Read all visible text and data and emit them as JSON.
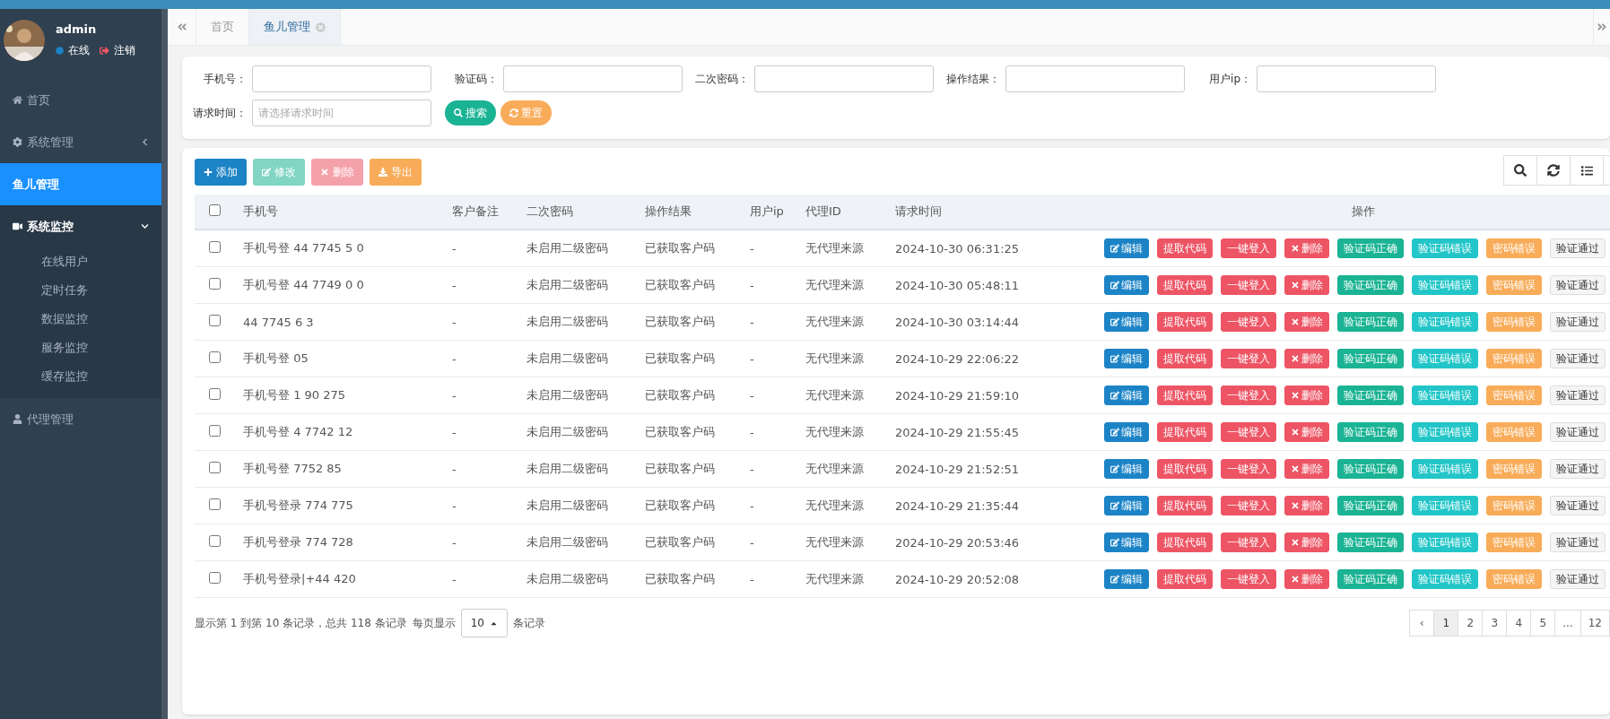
{
  "user": {
    "name": "admin",
    "status": "在线",
    "logout": "注销"
  },
  "sidebar": {
    "items": [
      {
        "label": "首页",
        "selected": false
      },
      {
        "label": "系统管理",
        "selected": false,
        "expanded": false
      },
      {
        "label": "鱼儿管理",
        "selected": true
      },
      {
        "label": "系统监控",
        "selected": false,
        "expanded": true,
        "children": [
          {
            "label": "在线用户",
            "selected": false
          },
          {
            "label": "定时任务",
            "selected": false
          },
          {
            "label": "数据监控",
            "selected": false
          },
          {
            "label": "服务监控",
            "selected": false
          },
          {
            "label": "缓存监控",
            "selected": false
          }
        ]
      },
      {
        "label": "代理管理",
        "selected": false
      }
    ]
  },
  "tabs": [
    {
      "label": "首页",
      "selected": false
    },
    {
      "label": "鱼儿管理",
      "selected": true
    }
  ],
  "filters": {
    "fields": [
      {
        "label": "手机号："
      },
      {
        "label": "验证码："
      },
      {
        "label": "二次密码："
      },
      {
        "label": "操作结果："
      },
      {
        "label": "用户ip："
      },
      {
        "label": "请求时间：",
        "placeholder": "请选择请求时间"
      }
    ],
    "buttons": [
      "搜索",
      "重置"
    ]
  },
  "toolbar": [
    {
      "label": "添加",
      "disabled": false
    },
    {
      "label": "修改",
      "disabled": true
    },
    {
      "label": "删除",
      "disabled": true
    },
    {
      "label": "导出",
      "disabled": false
    }
  ],
  "table": {
    "select_all": {
      "checked": false
    },
    "columns": [
      "手机号",
      "客户备注",
      "二次密码",
      "操作结果",
      "用户ip",
      "代理ID",
      "请求时间",
      "操作"
    ],
    "rows": [
      {
        "checked": false,
        "cells": [
          "手机号登 44 7745 5 0",
          "-",
          "未启用二级密码",
          "已获取客户码",
          "-",
          "无代理来源",
          "2024-10-30 06:31:25"
        ],
        "actions": [
          "编辑",
          "提取代码",
          "一键登入",
          "删除",
          "验证码正确",
          "验证码错误",
          "密码错误",
          "验证通过"
        ]
      },
      {
        "checked": false,
        "cells": [
          "手机号登 44 7749 0 0",
          "-",
          "未启用二级密码",
          "已获取客户码",
          "-",
          "无代理来源",
          "2024-10-30 05:48:11"
        ],
        "actions": [
          "编辑",
          "提取代码",
          "一键登入",
          "删除",
          "验证码正确",
          "验证码错误",
          "密码错误",
          "验证通过"
        ]
      },
      {
        "checked": false,
        "cells": [
          "44 7745 6 3",
          "-",
          "未启用二级密码",
          "已获取客户码",
          "-",
          "无代理来源",
          "2024-10-30 03:14:44"
        ],
        "actions": [
          "编辑",
          "提取代码",
          "一键登入",
          "删除",
          "验证码正确",
          "验证码错误",
          "密码错误",
          "验证通过"
        ]
      },
      {
        "checked": false,
        "cells": [
          "手机号登 05",
          "-",
          "未启用二级密码",
          "已获取客户码",
          "-",
          "无代理来源",
          "2024-10-29 22:06:22"
        ],
        "actions": [
          "编辑",
          "提取代码",
          "一键登入",
          "删除",
          "验证码正确",
          "验证码错误",
          "密码错误",
          "验证通过"
        ]
      },
      {
        "checked": false,
        "cells": [
          "手机号登 1 90 275",
          "-",
          "未启用二级密码",
          "已获取客户码",
          "-",
          "无代理来源",
          "2024-10-29 21:59:10"
        ],
        "actions": [
          "编辑",
          "提取代码",
          "一键登入",
          "删除",
          "验证码正确",
          "验证码错误",
          "密码错误",
          "验证通过"
        ]
      },
      {
        "checked": false,
        "cells": [
          "手机号登 4 7742 12",
          "-",
          "未启用二级密码",
          "已获取客户码",
          "-",
          "无代理来源",
          "2024-10-29 21:55:45"
        ],
        "actions": [
          "编辑",
          "提取代码",
          "一键登入",
          "删除",
          "验证码正确",
          "验证码错误",
          "密码错误",
          "验证通过"
        ]
      },
      {
        "checked": false,
        "cells": [
          "手机号登 7752 85",
          "-",
          "未启用二级密码",
          "已获取客户码",
          "-",
          "无代理来源",
          "2024-10-29 21:52:51"
        ],
        "actions": [
          "编辑",
          "提取代码",
          "一键登入",
          "删除",
          "验证码正确",
          "验证码错误",
          "密码错误",
          "验证通过"
        ]
      },
      {
        "checked": false,
        "cells": [
          "手机号登录 774 775",
          "-",
          "未启用二级密码",
          "已获取客户码",
          "-",
          "无代理来源",
          "2024-10-29 21:35:44"
        ],
        "actions": [
          "编辑",
          "提取代码",
          "一键登入",
          "删除",
          "验证码正确",
          "验证码错误",
          "密码错误",
          "验证通过"
        ]
      },
      {
        "checked": false,
        "cells": [
          "手机号登录 774 728",
          "-",
          "未启用二级密码",
          "已获取客户码",
          "-",
          "无代理来源",
          "2024-10-29 20:53:46"
        ],
        "actions": [
          "编辑",
          "提取代码",
          "一键登入",
          "删除",
          "验证码正确",
          "验证码错误",
          "密码错误",
          "验证通过"
        ]
      },
      {
        "checked": false,
        "cells": [
          "手机号登录|+44 420",
          "-",
          "未启用二级密码",
          "已获取客户码",
          "-",
          "无代理来源",
          "2024-10-29 20:52:08"
        ],
        "actions": [
          "编辑",
          "提取代码",
          "一键登入",
          "删除",
          "验证码正确",
          "验证码错误",
          "密码错误",
          "验证通过"
        ]
      }
    ]
  },
  "footer": {
    "summary": "显示第 1 到第 10 条记录，总共 118 条记录",
    "per_page_label": "每页显示",
    "per_page": "10",
    "per_page_suffix": "条记录"
  },
  "pagination": [
    {
      "label": "‹",
      "selected": false
    },
    {
      "label": "1",
      "selected": true
    },
    {
      "label": "2",
      "selected": false
    },
    {
      "label": "3",
      "selected": false
    },
    {
      "label": "4",
      "selected": false
    },
    {
      "label": "5",
      "selected": false
    },
    {
      "label": "...",
      "selected": false
    },
    {
      "label": "12",
      "selected": false
    }
  ]
}
